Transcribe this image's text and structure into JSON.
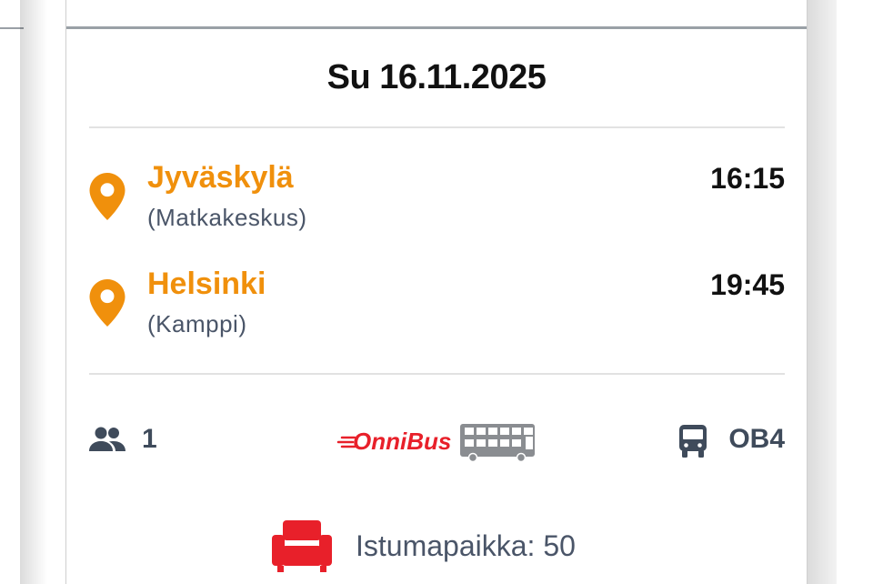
{
  "trip": {
    "date": "Su 16.11.2025",
    "departure": {
      "city": "Jyväskylä",
      "station": "(Matkakeskus)",
      "time": "16:15"
    },
    "arrival": {
      "city": "Helsinki",
      "station": "(Kamppi)",
      "time": "19:45"
    },
    "passengers": "1",
    "operator": "OnniBus",
    "bus_code": "OB4",
    "seat_label": "Istumapaikka: 50"
  },
  "colors": {
    "accent": "#f0900c",
    "brand": "#e8202a",
    "text_dark": "#111111",
    "text_muted": "#4a5568",
    "icon_gray": "#3f4b5b"
  },
  "icons": {
    "location": "map-pin-icon",
    "passengers": "people-icon",
    "bus": "bus-icon",
    "seat": "armchair-icon"
  }
}
